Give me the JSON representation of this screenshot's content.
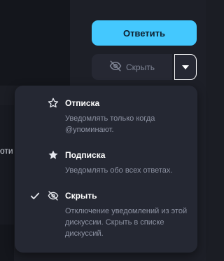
{
  "background": {
    "cut_text": "оти"
  },
  "actions": {
    "reply_label": "Ответить",
    "hide_label": "Скрыть"
  },
  "menu": {
    "items": [
      {
        "title": "Отписка",
        "description": "Уведомлять только когда @упоминают.",
        "icon": "star-outline-icon",
        "selected": false
      },
      {
        "title": "Подписка",
        "description": "Уведомлять обо всех ответах.",
        "icon": "star-filled-icon",
        "selected": false
      },
      {
        "title": "Скрыть",
        "description": "Отключение уведомлений из этой дискуссии. Скрыть в списке дискуссий.",
        "icon": "eye-slash-icon",
        "selected": true
      }
    ]
  },
  "colors": {
    "accent": "#44c8fe",
    "menu_bg": "#252833",
    "page_bg": "#1b1d24"
  }
}
